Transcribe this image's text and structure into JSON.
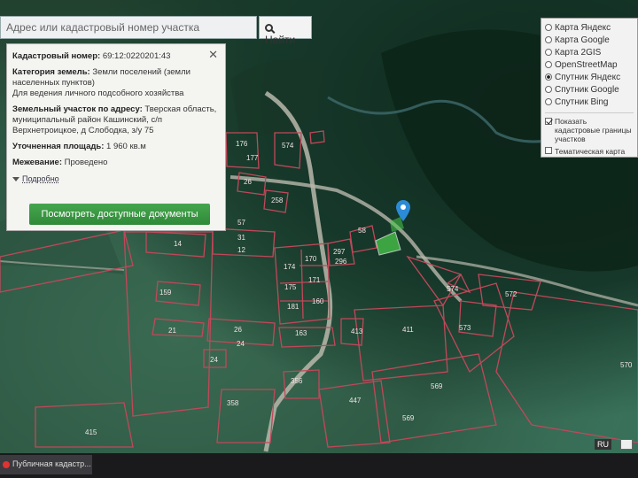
{
  "search": {
    "placeholder": "Адрес или кадастровый номер участка",
    "button_label": "Найти"
  },
  "info": {
    "cadastral_label": "Кадастровый номер:",
    "cadastral_value": "69:12:0220201:43",
    "category_label": "Категория земель:",
    "category_value": "Земли поселений (земли населенных пунктов)",
    "usage_value": "Для ведения личного подсобного хозяйства",
    "address_label": "Земельный участок по адресу:",
    "address_value": "Тверская область, муниципальный район Кашинский, с/п Верхнетроицкое, д Слободка, з/у 75",
    "area_label": "Уточненная площадь:",
    "area_value": "1 960 кв.м",
    "survey_label": "Межевание:",
    "survey_value": "Проведено",
    "more_link": "Подробно",
    "docs_button": "Посмотреть доступные документы",
    "close_icon": "close-icon"
  },
  "layers": {
    "base_maps": [
      {
        "label": "Карта Яндекс",
        "selected": false
      },
      {
        "label": "Карта Google",
        "selected": false
      },
      {
        "label": "Карта 2GIS",
        "selected": false
      },
      {
        "label": "OpenStreetMap",
        "selected": false
      },
      {
        "label": "Спутник Яндекс",
        "selected": true
      },
      {
        "label": "Спутник Google",
        "selected": false
      },
      {
        "label": "Спутник Bing",
        "selected": false
      }
    ],
    "overlays": [
      {
        "label": "Показать кадастровые границы участков",
        "checked": true
      },
      {
        "label": "Тематическая карта",
        "checked": false
      }
    ]
  },
  "parcel_labels": [
    "176",
    "177",
    "574",
    "26",
    "258",
    "57",
    "14",
    "297",
    "296",
    "174",
    "170",
    "175",
    "171",
    "181",
    "160",
    "159",
    "21",
    "26",
    "163",
    "413",
    "411",
    "574",
    "572",
    "573",
    "24",
    "356",
    "358",
    "447",
    "569",
    "569",
    "415",
    "570",
    "31",
    "12",
    "58",
    "24"
  ],
  "taskbar": {
    "item_label": "Публичная кадастр..."
  },
  "lang": "RU",
  "colors": {
    "accent_button": "#3a9a44",
    "parcel_border": "#c0485a",
    "highlight_parcel": "#49c94a",
    "marker": "#2c8bd6"
  }
}
